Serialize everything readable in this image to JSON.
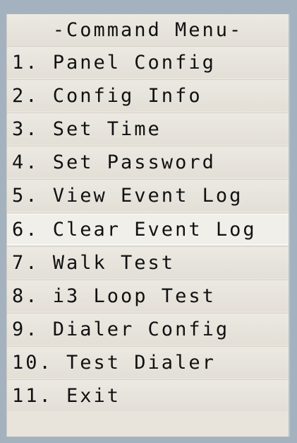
{
  "menu": {
    "title": "-Command Menu-",
    "items": [
      "1. Panel Config",
      "2. Config Info",
      "3. Set Time",
      "4. Set Password",
      "5. View Event Log",
      "6. Clear Event Log",
      "7. Walk Test",
      "8. i3 Loop Test",
      "9. Dialer Config",
      "10. Test Dialer",
      "11. Exit"
    ]
  },
  "colors": {
    "page_background": "#a4b2bf",
    "menu_background": "#e8e4dc",
    "text": "#111111"
  }
}
